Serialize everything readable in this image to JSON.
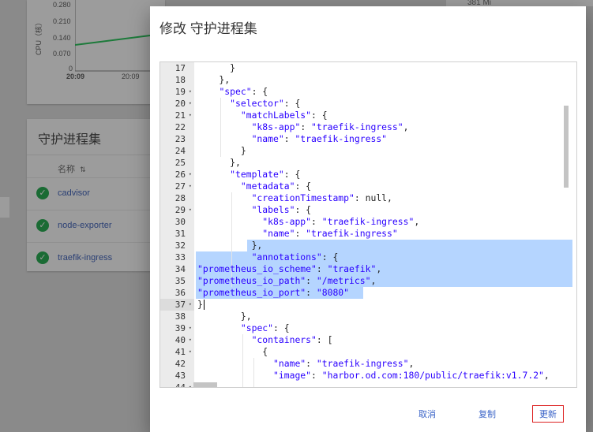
{
  "background": {
    "chart": {
      "y_axis_title": "CPU（核）",
      "y_ticks": [
        "0.280",
        "0.210",
        "0.140",
        "0.070",
        "0"
      ],
      "x_ticks": [
        "20:09",
        "20:09"
      ]
    },
    "right_card_value": "381 Mi",
    "daemonsets_panel": {
      "title": "守护进程集",
      "column_header": "名称",
      "rows": [
        "cadvisor",
        "node-exporter",
        "traefik-ingress"
      ]
    }
  },
  "dialog": {
    "title": "修改 守护进程集",
    "editor": {
      "active_line": 37,
      "lines": [
        {
          "no": "17",
          "fold": false,
          "text": "      }"
        },
        {
          "no": "18",
          "fold": false,
          "text": "    },"
        },
        {
          "no": "19",
          "fold": true,
          "text": "    \"spec\": {"
        },
        {
          "no": "20",
          "fold": true,
          "text": "      \"selector\": {"
        },
        {
          "no": "21",
          "fold": true,
          "text": "        \"matchLabels\": {"
        },
        {
          "no": "22",
          "fold": false,
          "text": "          \"k8s-app\": \"traefik-ingress\","
        },
        {
          "no": "23",
          "fold": false,
          "text": "          \"name\": \"traefik-ingress\""
        },
        {
          "no": "24",
          "fold": false,
          "text": "        }"
        },
        {
          "no": "25",
          "fold": false,
          "text": "      },"
        },
        {
          "no": "26",
          "fold": true,
          "text": "      \"template\": {"
        },
        {
          "no": "27",
          "fold": true,
          "text": "        \"metadata\": {"
        },
        {
          "no": "28",
          "fold": false,
          "text": "          \"creationTimestamp\": null,"
        },
        {
          "no": "29",
          "fold": true,
          "text": "          \"labels\": {"
        },
        {
          "no": "30",
          "fold": false,
          "text": "            \"k8s-app\": \"traefik-ingress\","
        },
        {
          "no": "31",
          "fold": false,
          "text": "            \"name\": \"traefik-ingress\""
        },
        {
          "no": "32",
          "fold": false,
          "text": "          },"
        },
        {
          "no": "33",
          "fold": false,
          "text": "          \"annotations\": {"
        },
        {
          "no": "34",
          "fold": false,
          "text": "\"prometheus_io_scheme\": \"traefik\","
        },
        {
          "no": "35",
          "fold": false,
          "text": "\"prometheus_io_path\": \"/metrics\","
        },
        {
          "no": "36",
          "fold": false,
          "text": "\"prometheus_io_port\": \"8080\""
        },
        {
          "no": "37",
          "fold": true,
          "text": "}"
        },
        {
          "no": "38",
          "fold": false,
          "text": "        },"
        },
        {
          "no": "39",
          "fold": true,
          "text": "        \"spec\": {"
        },
        {
          "no": "40",
          "fold": true,
          "text": "          \"containers\": ["
        },
        {
          "no": "41",
          "fold": true,
          "text": "            {"
        },
        {
          "no": "42",
          "fold": false,
          "text": "              \"name\": \"traefik-ingress\","
        },
        {
          "no": "43",
          "fold": false,
          "text": "              \"image\": \"harbor.od.com:180/public/traefik:v1.7.2\","
        },
        {
          "no": "44",
          "fold": true,
          "text": ""
        }
      ]
    },
    "buttons": {
      "cancel": "取消",
      "copy": "复制",
      "update": "更新"
    }
  },
  "colors": {
    "accent": "#3b64c8",
    "selection": "#b5d5ff",
    "json_key": "#2a00ff",
    "update_border": "#dd2222"
  }
}
